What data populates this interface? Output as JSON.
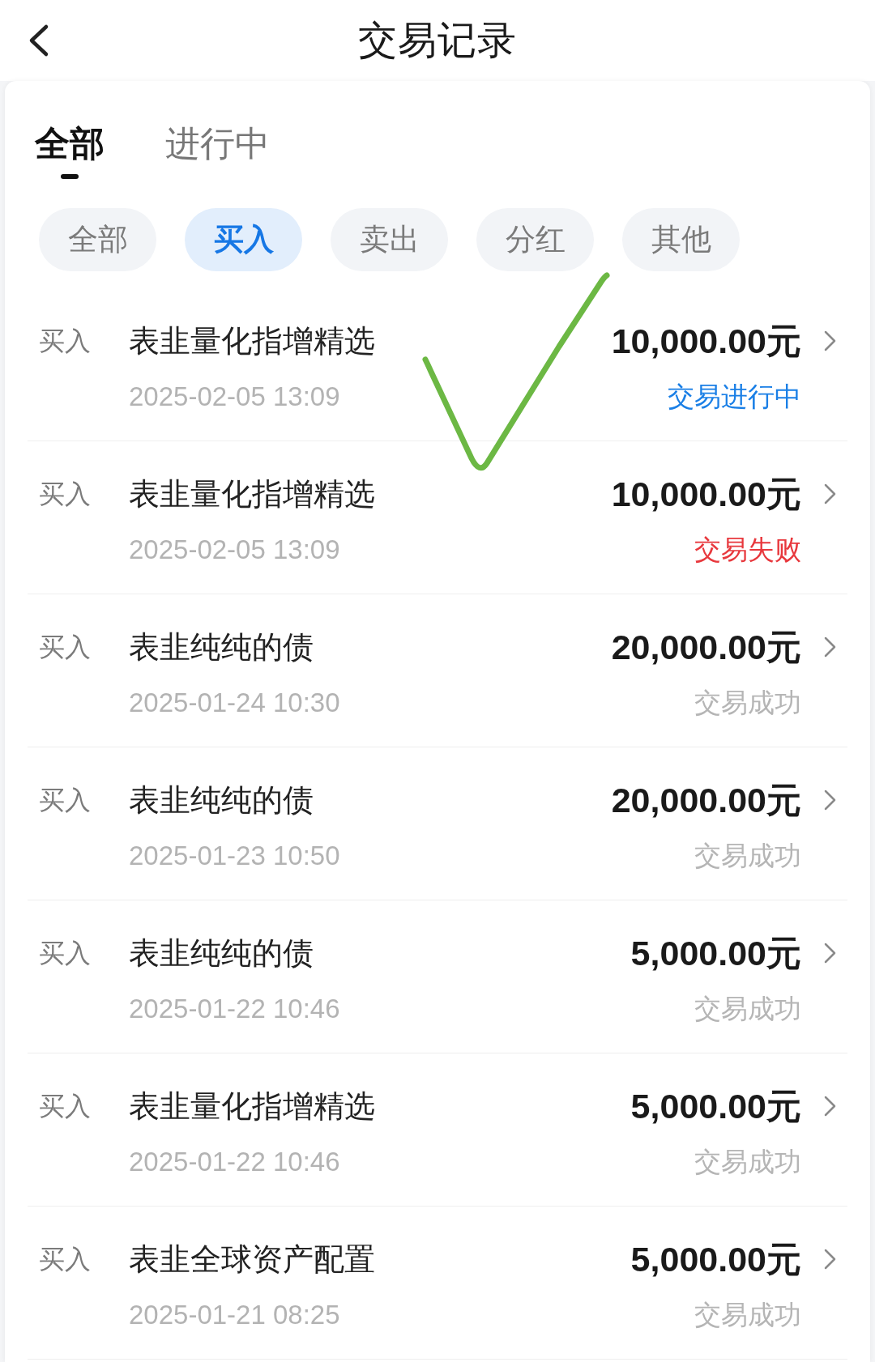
{
  "header": {
    "title": "交易记录"
  },
  "tabs": [
    {
      "label": "全部",
      "selected": true
    },
    {
      "label": "进行中",
      "selected": false
    }
  ],
  "filters": [
    {
      "label": "全部",
      "selected": false
    },
    {
      "label": "买入",
      "selected": true
    },
    {
      "label": "卖出",
      "selected": false
    },
    {
      "label": "分红",
      "selected": false
    },
    {
      "label": "其他",
      "selected": false
    }
  ],
  "transactions": [
    {
      "type": "买入",
      "fund": "表韭量化指增精选",
      "time": "2025-02-05 13:09",
      "amount": "10,000.00元",
      "status": {
        "text": "交易进行中",
        "color": "#1a7fe6"
      }
    },
    {
      "type": "买入",
      "fund": "表韭量化指增精选",
      "time": "2025-02-05 13:09",
      "amount": "10,000.00元",
      "status": {
        "text": "交易失败",
        "color": "#e8383d"
      }
    },
    {
      "type": "买入",
      "fund": "表韭纯纯的债",
      "time": "2025-01-24 10:30",
      "amount": "20,000.00元",
      "status": {
        "text": "交易成功",
        "color": "#b5b5b5"
      }
    },
    {
      "type": "买入",
      "fund": "表韭纯纯的债",
      "time": "2025-01-23 10:50",
      "amount": "20,000.00元",
      "status": {
        "text": "交易成功",
        "color": "#b5b5b5"
      }
    },
    {
      "type": "买入",
      "fund": "表韭纯纯的债",
      "time": "2025-01-22 10:46",
      "amount": "5,000.00元",
      "status": {
        "text": "交易成功",
        "color": "#b5b5b5"
      }
    },
    {
      "type": "买入",
      "fund": "表韭量化指增精选",
      "time": "2025-01-22 10:46",
      "amount": "5,000.00元",
      "status": {
        "text": "交易成功",
        "color": "#b5b5b5"
      }
    },
    {
      "type": "买入",
      "fund": "表韭全球资产配置",
      "time": "2025-01-21 08:25",
      "amount": "5,000.00元",
      "status": {
        "text": "交易成功",
        "color": "#b5b5b5"
      }
    }
  ]
}
